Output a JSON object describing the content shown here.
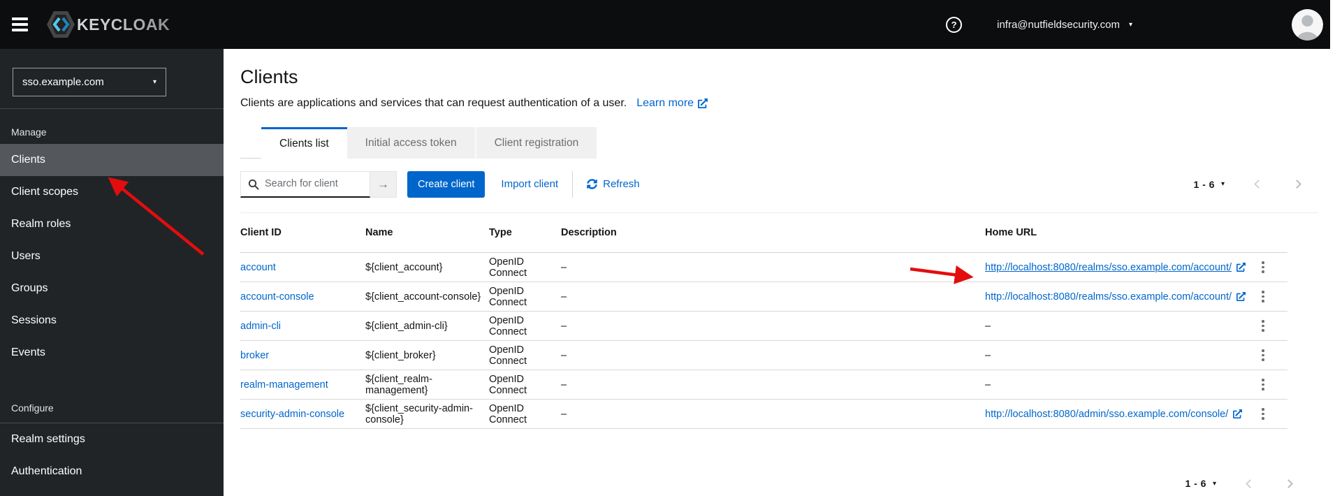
{
  "header": {
    "brand": "KEYCLOAK",
    "user_email": "infra@nutfieldsecurity.com"
  },
  "sidebar": {
    "realm_selector": "sso.example.com",
    "manage_label": "Manage",
    "manage_items": [
      "Clients",
      "Client scopes",
      "Realm roles",
      "Users",
      "Groups",
      "Sessions",
      "Events"
    ],
    "selected_item": "Clients",
    "configure_label": "Configure",
    "configure_items": [
      "Realm settings",
      "Authentication"
    ]
  },
  "page": {
    "title": "Clients",
    "description": "Clients are applications and services that can request authentication of a user.",
    "learn_more_label": "Learn more",
    "tabs": [
      {
        "label": "Clients list",
        "active": true
      },
      {
        "label": "Initial access token",
        "active": false
      },
      {
        "label": "Client registration",
        "active": false
      }
    ]
  },
  "toolbar": {
    "search_placeholder": "Search for client",
    "create_button_label": "Create client",
    "import_link_label": "Import client",
    "refresh_label": "Refresh",
    "pagination_range": "1 - 6"
  },
  "table": {
    "columns": [
      "Client ID",
      "Name",
      "Type",
      "Description",
      "Home URL"
    ],
    "rows": [
      {
        "client_id": "account",
        "name": "${client_account}",
        "type": "OpenID Connect",
        "description": "–",
        "home_url": "http://localhost:8080/realms/sso.example.com/account/"
      },
      {
        "client_id": "account-console",
        "name": "${client_account-console}",
        "type": "OpenID Connect",
        "description": "–",
        "home_url": "http://localhost:8080/realms/sso.example.com/account/"
      },
      {
        "client_id": "admin-cli",
        "name": "${client_admin-cli}",
        "type": "OpenID Connect",
        "description": "–",
        "home_url": "–"
      },
      {
        "client_id": "broker",
        "name": "${client_broker}",
        "type": "OpenID Connect",
        "description": "–",
        "home_url": "–"
      },
      {
        "client_id": "realm-management",
        "name": "${client_realm-management}",
        "type": "OpenID Connect",
        "description": "–",
        "home_url": "–"
      },
      {
        "client_id": "security-admin-console",
        "name": "${client_security-admin-console}",
        "type": "OpenID Connect",
        "description": "–",
        "home_url": "http://localhost:8080/admin/sso.example.com/console/"
      }
    ]
  },
  "footer": {
    "pagination_range": "1 - 6"
  },
  "icons": {
    "caret": "▾",
    "submit_arrow": "→",
    "help": "?"
  },
  "colors": {
    "accent": "#0066cc",
    "link": "#0066cc",
    "masthead": "#0c0d0e",
    "sidebar": "#212427",
    "selected_nav": "#54575c",
    "annotation": "#e40d0d"
  }
}
